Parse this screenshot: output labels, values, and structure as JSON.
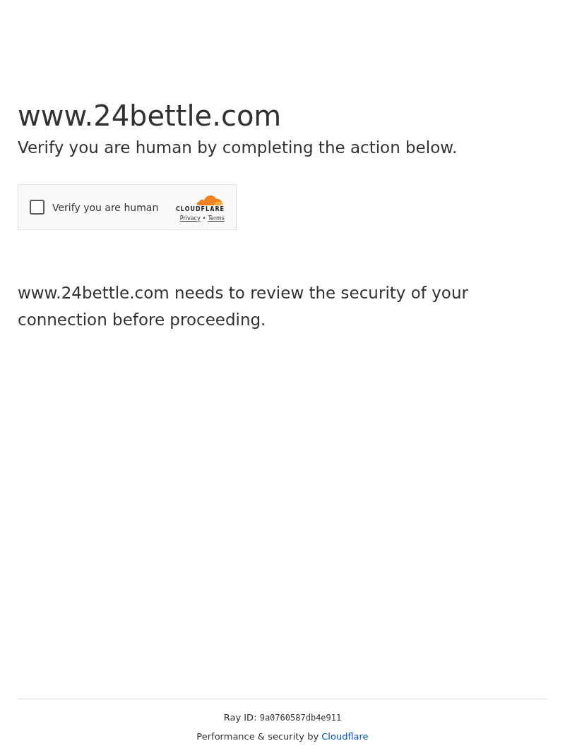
{
  "heading": "www.24bettle.com",
  "subtitle": "Verify you are human by completing the action below.",
  "challenge": {
    "checked": false,
    "label": "Verify you are human",
    "brand": "CLOUDFLARE",
    "links": [
      "Privacy",
      "Terms"
    ],
    "separator": "•"
  },
  "message": "www.24bettle.com needs to review the security of your connection before proceeding.",
  "footer": {
    "ray_label": "Ray ID: ",
    "ray_id": "9a0760587db4e911",
    "credit": "Performance & security by ",
    "credit_link": "Cloudflare"
  }
}
